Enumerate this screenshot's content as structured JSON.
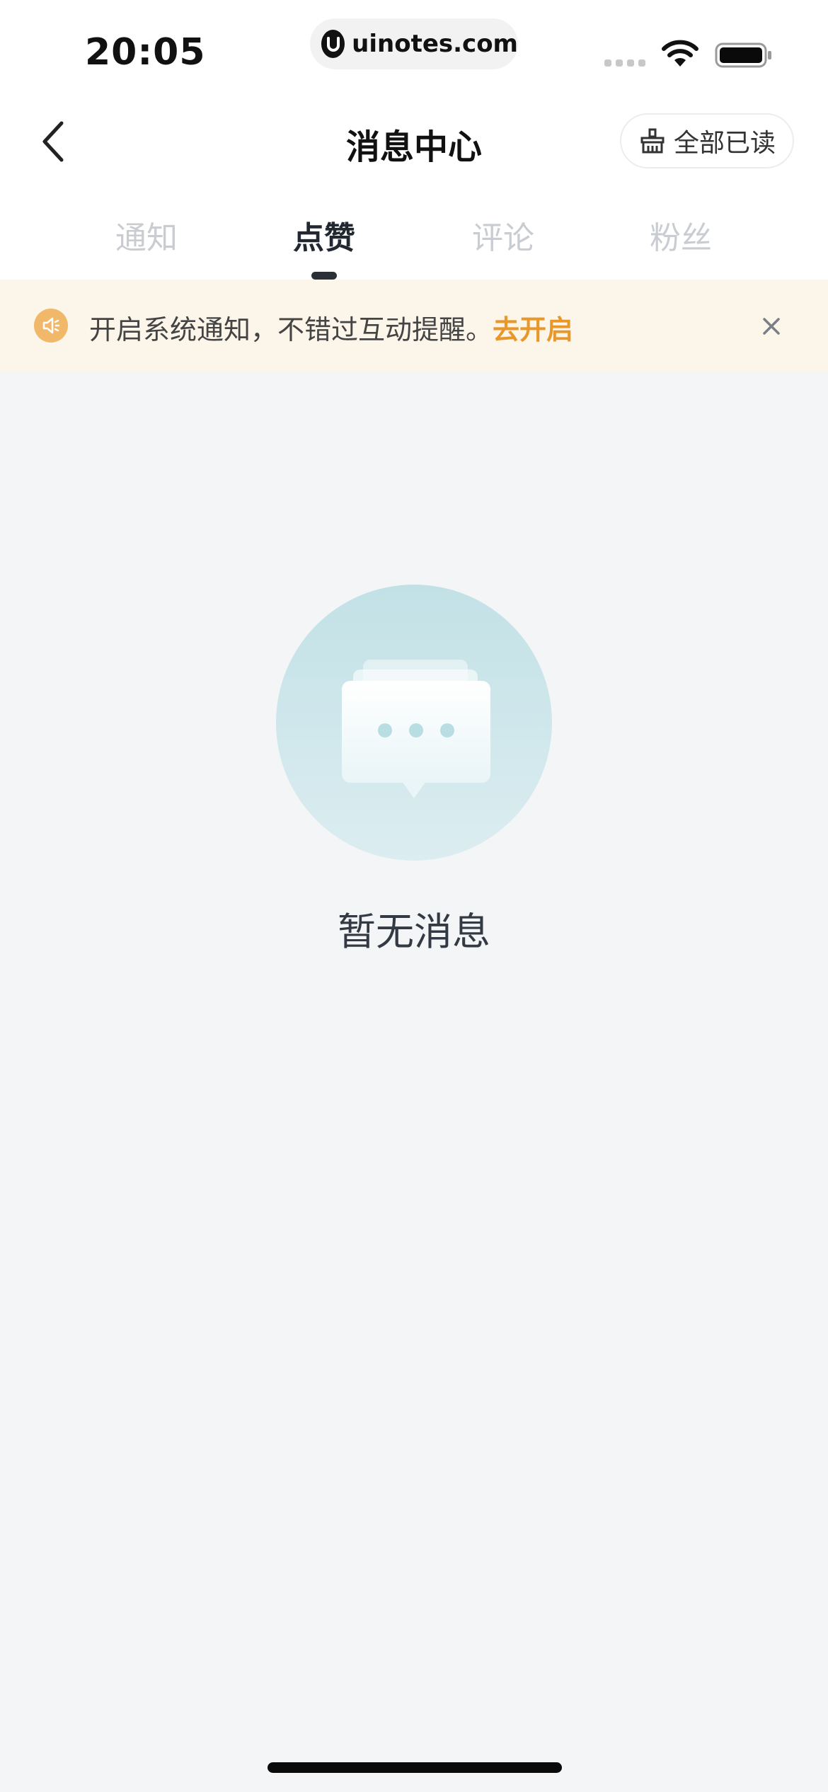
{
  "status_bar": {
    "time": "20:05",
    "url": "uinotes.com",
    "icons": [
      "signal-icon",
      "wifi-icon",
      "battery-icon"
    ]
  },
  "nav": {
    "title": "消息中心",
    "mark_all_read": "全部已读",
    "icons": [
      "back-arrow-icon",
      "broom-icon"
    ]
  },
  "tabs": [
    {
      "label": "通知",
      "active": false
    },
    {
      "label": "点赞",
      "active": true
    },
    {
      "label": "评论",
      "active": false
    },
    {
      "label": "粉丝",
      "active": false
    }
  ],
  "notice": {
    "text": "开启系统通知，不错过互动提醒。",
    "action": "去开启",
    "icons": [
      "speaker-icon",
      "close-icon"
    ]
  },
  "empty_state": {
    "message": "暂无消息",
    "icon": "chat-bubble-icon"
  },
  "colors": {
    "background": "#f4f5f7",
    "accent": "#e8982a",
    "notice_bg": "#fcf5ea",
    "empty_circle": "#c5e3e8"
  }
}
